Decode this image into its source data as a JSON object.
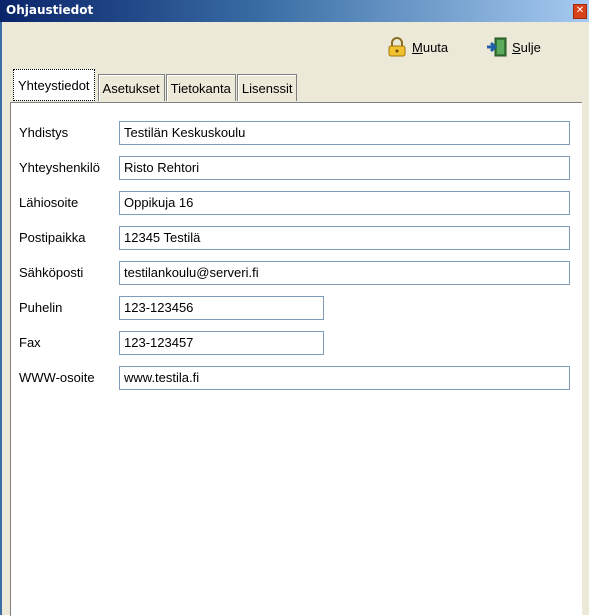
{
  "window": {
    "title": "Ohjaustiedot",
    "close_glyph": "✕"
  },
  "toolbar": {
    "edit": {
      "label_underlined": "M",
      "label_rest": "uuta",
      "icon": "lock-icon"
    },
    "close": {
      "label_underlined": "S",
      "label_rest": "ulje",
      "icon": "exit-door-icon"
    }
  },
  "tabs": [
    {
      "label": "Yhteystiedot",
      "active": true
    },
    {
      "label": "Asetukset",
      "active": false
    },
    {
      "label": "Tietokanta",
      "active": false
    },
    {
      "label": "Lisenssit",
      "active": false
    }
  ],
  "fields": [
    {
      "label": "Yhdistys",
      "value": "Testilän Keskuskoulu"
    },
    {
      "label": "Yhteyshenkilö",
      "value": "Risto Rehtori"
    },
    {
      "label": "Lähiosoite",
      "value": "Oppikuja 16"
    },
    {
      "label": "Postipaikka",
      "value": "12345 Testilä"
    },
    {
      "label": "Sähköposti",
      "value": "testilankoulu@serveri.fi"
    },
    {
      "label": "Puhelin",
      "value": "123-123456"
    },
    {
      "label": "Fax",
      "value": "123-123457"
    },
    {
      "label": "WWW-osoite",
      "value": "www.testila.fi"
    }
  ],
  "colors": {
    "titlebar": "#0a246a",
    "window_bg": "#ece9d8",
    "input_border": "#7f9db9"
  }
}
